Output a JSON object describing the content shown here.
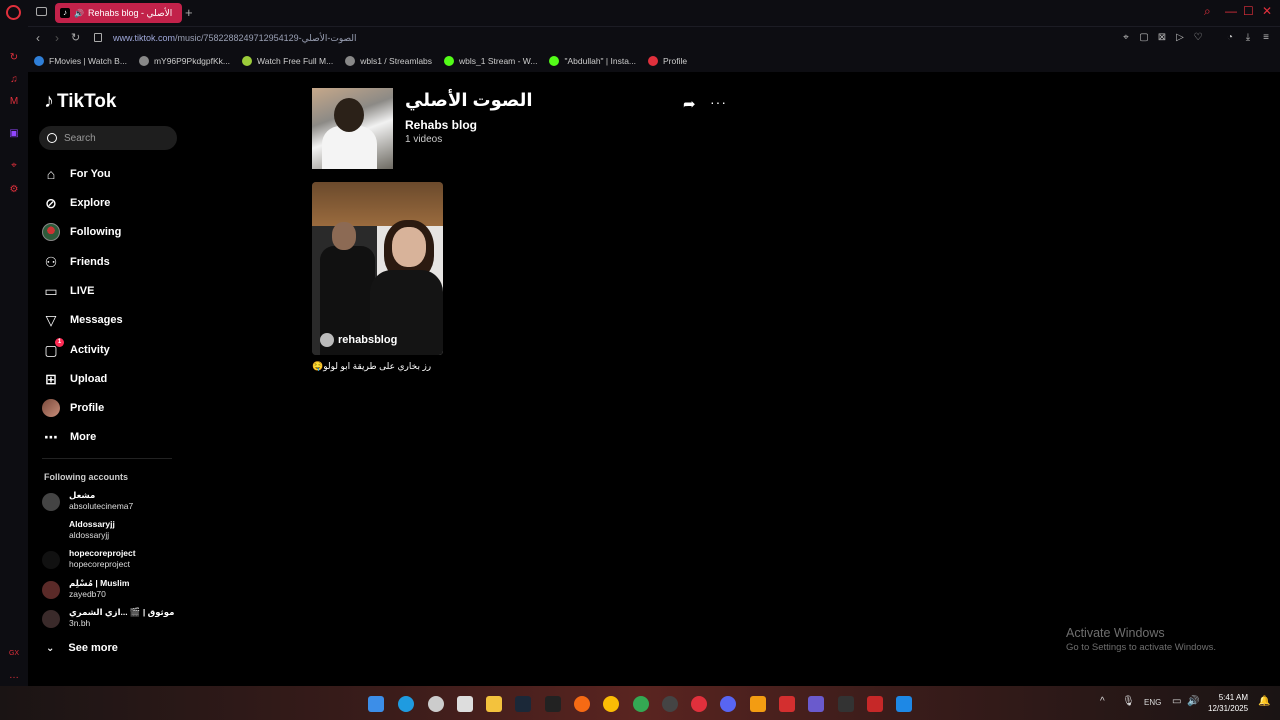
{
  "browser": {
    "tab_title": "Rehabs blog - الأصلي",
    "url_host": "www.tiktok.com",
    "url_path": "/music/7582288249712954129-الصوت-الأصلي"
  },
  "bookmarks": [
    {
      "label": "FMovies | Watch B...",
      "color": "#2f7fd8"
    },
    {
      "label": "mY96P9PkdgpfKk...",
      "color": "#888888"
    },
    {
      "label": "Watch Free Full M...",
      "color": "#9ccc3a"
    },
    {
      "label": "wbls1 / Streamlabs",
      "color": "#888888"
    },
    {
      "label": "wbls_1 Stream - W...",
      "color": "#53fc18"
    },
    {
      "label": "\"Abdullah\" | Insta...",
      "color": "#53fc18"
    },
    {
      "label": "Profile",
      "color": "#e0303c"
    }
  ],
  "sidebar": {
    "logo": "TikTok",
    "search_placeholder": "Search",
    "menu": [
      {
        "label": "For You",
        "icon": "home-icon"
      },
      {
        "label": "Explore",
        "icon": "compass-icon"
      },
      {
        "label": "Following",
        "icon": "following-avatar"
      },
      {
        "label": "Friends",
        "icon": "friends-icon"
      },
      {
        "label": "LIVE",
        "icon": "live-icon"
      },
      {
        "label": "Messages",
        "icon": "send-icon"
      },
      {
        "label": "Activity",
        "icon": "inbox-icon",
        "badge": "1"
      },
      {
        "label": "Upload",
        "icon": "plus-square-icon"
      },
      {
        "label": "Profile",
        "icon": "profile-avatar"
      },
      {
        "label": "More",
        "icon": "ellipsis-icon"
      }
    ],
    "following_title": "Following accounts",
    "accounts": [
      {
        "name": "مشعل",
        "handle": "absolutecinema7"
      },
      {
        "name": "Aldossaryjj",
        "handle": "aldossaryjj"
      },
      {
        "name": "hopecoreproject",
        "handle": "hopecoreproject"
      },
      {
        "name": "مُسْلِم | Muslim",
        "handle": "zayedb70"
      },
      {
        "name": "موثوق | 🎬 ...ازي الشمري",
        "handle": "3n.bh"
      }
    ],
    "see_more": "See more"
  },
  "music": {
    "title": "الصوت الأصلي",
    "author": "Rehabs blog",
    "count": "1 videos"
  },
  "video": {
    "username": "rehabsblog",
    "caption": "رز بخاري على طريقة ابو لولو🤤"
  },
  "watermark": {
    "line1": "Activate Windows",
    "line2": "Go to Settings to activate Windows."
  },
  "taskbar": {
    "lang": "ENG",
    "time": "5:41 AM",
    "date": "12/31/2025"
  }
}
